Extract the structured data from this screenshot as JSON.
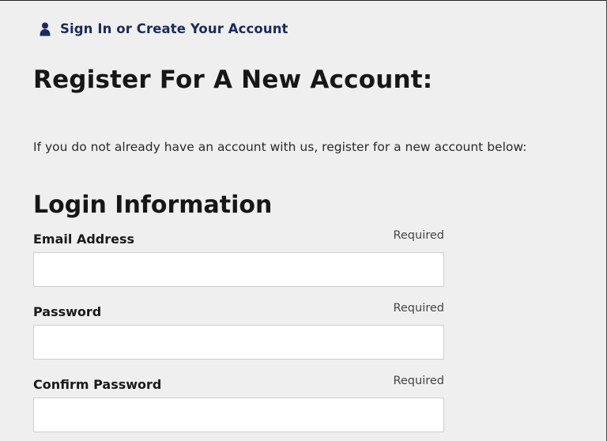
{
  "header": {
    "signin_label": "Sign In or Create Your Account",
    "signin_icon": "user-icon",
    "link_color": "#1c2a5e"
  },
  "page": {
    "title": "Register For A New Account:",
    "intro": "If you do not already have an account with us, register for a new account below:"
  },
  "login_section": {
    "title": "Login Information",
    "fields": [
      {
        "label": "Email Address",
        "required_label": "Required",
        "value": "",
        "placeholder": ""
      },
      {
        "label": "Password",
        "required_label": "Required",
        "value": "",
        "placeholder": ""
      },
      {
        "label": "Confirm Password",
        "required_label": "Required",
        "value": "",
        "placeholder": ""
      }
    ]
  }
}
